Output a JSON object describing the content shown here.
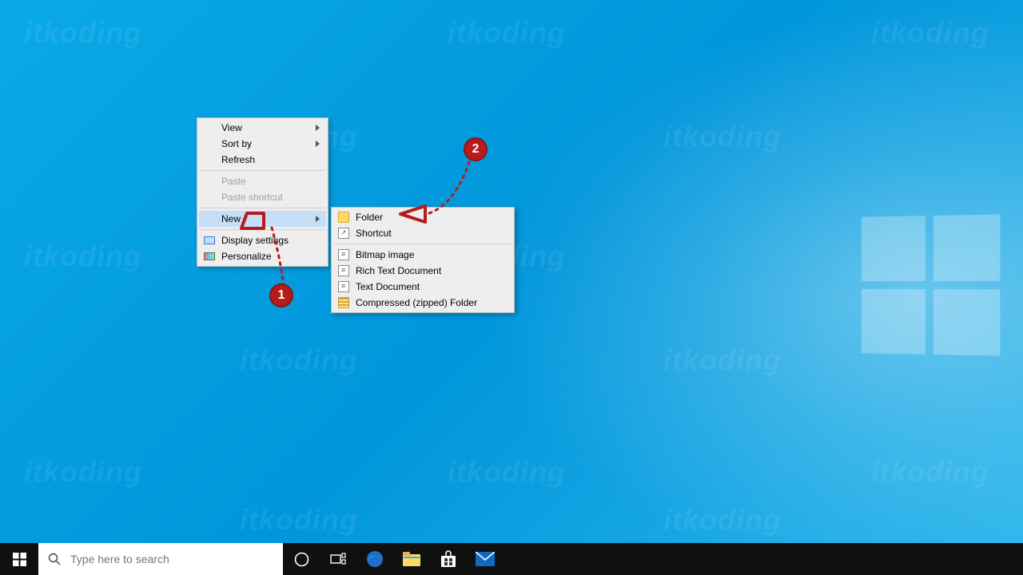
{
  "watermark_text": "itkoding",
  "context_menu": {
    "items": [
      {
        "label": "View",
        "arrow": true
      },
      {
        "label": "Sort by",
        "arrow": true
      },
      {
        "label": "Refresh"
      }
    ],
    "items2": [
      {
        "label": "Paste",
        "disabled": true
      },
      {
        "label": "Paste shortcut",
        "disabled": true
      }
    ],
    "new_label": "New",
    "items3": [
      {
        "label": "Display settings",
        "icon": "display"
      },
      {
        "label": "Personalize",
        "icon": "personalize"
      }
    ]
  },
  "submenu": {
    "items1": [
      {
        "label": "Folder",
        "icon": "folder"
      },
      {
        "label": "Shortcut",
        "icon": "shortcut"
      }
    ],
    "items2": [
      {
        "label": "Bitmap image",
        "icon": "doc"
      },
      {
        "label": "Rich Text Document",
        "icon": "doc"
      },
      {
        "label": "Text Document",
        "icon": "doc"
      },
      {
        "label": "Compressed (zipped) Folder",
        "icon": "zip"
      }
    ]
  },
  "annotations": {
    "badge1": "1",
    "badge2": "2"
  },
  "taskbar": {
    "search_placeholder": "Type here to search"
  }
}
